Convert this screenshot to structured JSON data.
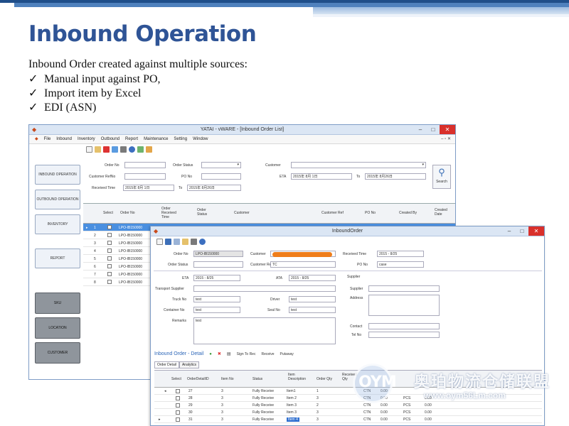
{
  "slide": {
    "title": "Inbound Operation",
    "intro": "Inbound Order created against multiple sources:",
    "bullets": [
      "Manual input against PO,",
      "Import item by Excel",
      "EDI (ASN)"
    ]
  },
  "main_window": {
    "title": "YATAI - vWARE - [Inbound Order List]",
    "menu": [
      "File",
      "Inbound",
      "Inventory",
      "Outbound",
      "Report",
      "Maintenance",
      "Setting",
      "Window"
    ],
    "sidebar": {
      "inbound": "INBOUND OPERATION",
      "outbound": "OUTBOUND OPERATION",
      "inventory": "INVENTORY",
      "report": "REPORT",
      "sku": "SKU",
      "location": "LOCATION",
      "customer": "CUSTOMER"
    },
    "search": {
      "order_no_label": "Order No",
      "order_status_label": "Order Status",
      "customer_label": "Customer",
      "customer_refno_label": "Customer RefNo",
      "po_no_label": "PO No",
      "eta_label": "ETA",
      "eta_from": "2015年 8月 1日",
      "to_label": "To",
      "eta_to": "2015年 8月26日",
      "received_time_label": "Received Time",
      "received_from": "2015年 8月 1日",
      "received_to": "2015年 8月26日",
      "search_button": "Search"
    },
    "grid": {
      "headers": [
        "Select",
        "Order No",
        "Order Received Time",
        "Order Status",
        "Customer",
        "Customer Ref",
        "PO No",
        "Created By",
        "Created Date"
      ],
      "rows": [
        {
          "num": "1",
          "order": "LPO-IB150000"
        },
        {
          "num": "2",
          "order": "LPO-IB150000"
        },
        {
          "num": "3",
          "order": "LPO-IB150000"
        },
        {
          "num": "4",
          "order": "LPO-IB150000"
        },
        {
          "num": "5",
          "order": "LPO-IB150000"
        },
        {
          "num": "6",
          "order": "LPO-IB150000"
        },
        {
          "num": "7",
          "order": "LPO-IB150000"
        },
        {
          "num": "8",
          "order": "LPO-IB150000"
        }
      ]
    }
  },
  "detail_window": {
    "title": "InboundOrder",
    "order_no_label": "Order No",
    "order_no_value": "LPO-IB150000",
    "customer_label": "Customer",
    "received_time_label": "Received Time",
    "received_time_value": "2015 - 8/25",
    "order_status_label": "Order Status",
    "customer_refno_label": "Customer RefNo",
    "customer_refno_value": "TC",
    "po_no_label": "PO No",
    "po_no_value": "case",
    "eta_label": "ETA",
    "eta_value": "2015 - 8/25",
    "ata_label": "ATA",
    "ata_value": "2015 - 8/25",
    "supplier_section": "Supplier",
    "transport_supplier_label": "Transport Supplier",
    "truck_no_label": "Truck No",
    "truck_no_value": "test",
    "driver_label": "Driver",
    "driver_value": "test",
    "container_no_label": "Container No",
    "container_no_value": "test",
    "seal_no_label": "Seal No",
    "seal_no_value": "test",
    "remarks_label": "Remarks",
    "remarks_value": "test",
    "supplier_label": "Supplier",
    "address_label": "Address",
    "contact_label": "Contact",
    "tel_label": "Tel No",
    "detail_title": "Inbound Order - Detail",
    "actions": [
      "Sign To Rec",
      "Receive",
      "Putaway"
    ],
    "tabs": [
      "Order Detail",
      "Analytics"
    ],
    "grid_headers": [
      "Select",
      "OrderDetailID",
      "Item No",
      "Status",
      "Item Description",
      "Order Qty",
      "Received Qty"
    ],
    "rows": [
      {
        "id": "27",
        "item": "3",
        "status": "Fully Receive",
        "desc": "Item1",
        "qty": "1"
      },
      {
        "id": "28",
        "item": "3",
        "status": "Fully Receive",
        "desc": "Item 2",
        "qty": "3"
      },
      {
        "id": "29",
        "item": "3",
        "status": "Fully Receive",
        "desc": "Item 3",
        "qty": "2"
      },
      {
        "id": "30",
        "item": "3",
        "status": "Fully Receive",
        "desc": "Item 3",
        "qty": "3"
      },
      {
        "id": "31",
        "item": "3",
        "status": "Fully Receive",
        "desc": "Item 4",
        "qty": "3"
      }
    ],
    "row_extras": [
      "CTN",
      "0.00",
      "PCS",
      "0.00"
    ]
  },
  "watermark": {
    "logo": "OYM",
    "name": "奥珀物流仓储联盟",
    "url": "www.oym56Lm.com"
  }
}
